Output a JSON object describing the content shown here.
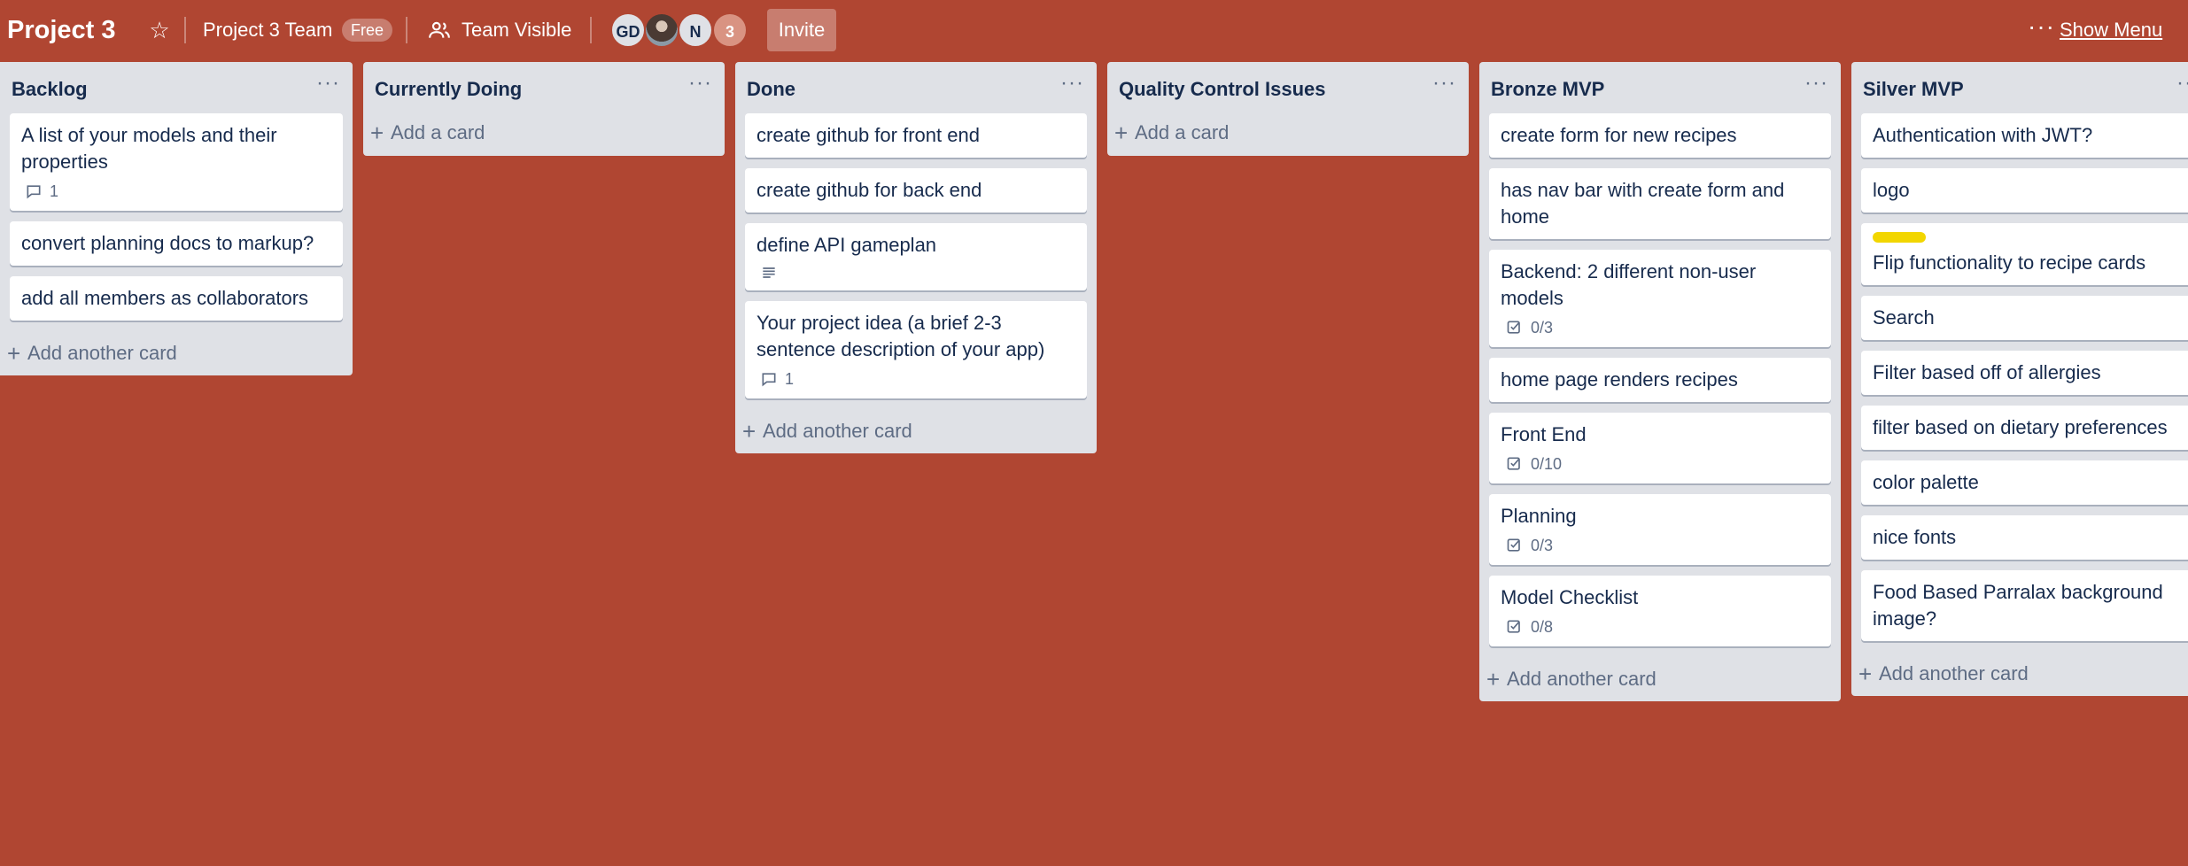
{
  "header": {
    "board_title": "Project 3",
    "team_name": "Project 3 Team",
    "plan_badge": "Free",
    "visibility": "Team Visible",
    "members": [
      "GD",
      "N"
    ],
    "more_members": "3",
    "invite_label": "Invite",
    "show_menu_label": "Show Menu"
  },
  "lists": [
    {
      "title": "Backlog",
      "add_label": "Add another card",
      "cards": [
        {
          "title": "A list of your models and their properties",
          "comments": "1"
        },
        {
          "title": "convert planning docs to markup?"
        },
        {
          "title": "add all members as collaborators"
        }
      ]
    },
    {
      "title": "Currently Doing",
      "add_label": "Add a card",
      "cards": []
    },
    {
      "title": "Done",
      "add_label": "Add another card",
      "cards": [
        {
          "title": "create github for front end"
        },
        {
          "title": "create github for back end"
        },
        {
          "title": "define API gameplan",
          "description": true
        },
        {
          "title": "Your project idea (a brief 2-3 sentence description of your app)",
          "comments": "1"
        }
      ]
    },
    {
      "title": "Quality Control Issues",
      "add_label": "Add a card",
      "cards": []
    },
    {
      "title": "Bronze MVP",
      "add_label": "Add another card",
      "cards": [
        {
          "title": "create form for new recipes"
        },
        {
          "title": "has nav bar with create form and home"
        },
        {
          "title": "Backend: 2 different non-user models",
          "checklist": "0/3"
        },
        {
          "title": "home page renders recipes"
        },
        {
          "title": "Front End",
          "checklist": "0/10"
        },
        {
          "title": "Planning",
          "checklist": "0/3"
        },
        {
          "title": "Model Checklist",
          "checklist": "0/8"
        }
      ]
    },
    {
      "title": "Silver MVP",
      "add_label": "Add another card",
      "cards": [
        {
          "title": "Authentication with JWT?"
        },
        {
          "title": "logo"
        },
        {
          "title": "Flip functionality to recipe cards",
          "label_color": "#f2d600"
        },
        {
          "title": "Search"
        },
        {
          "title": "Filter based off of allergies"
        },
        {
          "title": "filter based on dietary preferences"
        },
        {
          "title": "color palette"
        },
        {
          "title": "nice fonts"
        },
        {
          "title": "Food Based Parralax background image?"
        }
      ]
    }
  ],
  "colors": {
    "board_background": "#b04632",
    "list_background": "#dfe1e6",
    "label_yellow": "#f2d600"
  },
  "icons": {
    "star": "star-icon",
    "visibility": "team-visible-icon",
    "comment": "comment-icon",
    "checklist": "checklist-icon",
    "description": "description-icon"
  }
}
